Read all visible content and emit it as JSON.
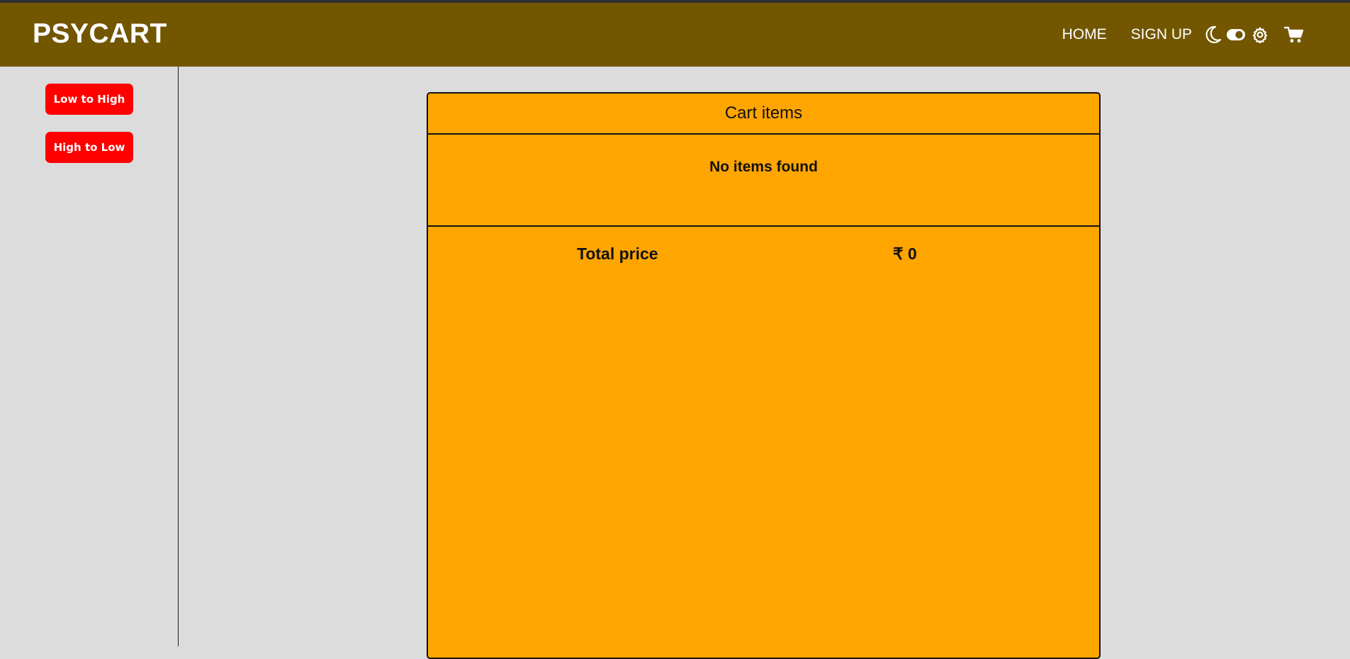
{
  "brand": {
    "name": "PSYCART"
  },
  "nav": {
    "home_label": "HOME",
    "signup_label": "SIGN UP",
    "icons": [
      "moon-icon",
      "toggle-icon",
      "gear-icon",
      "cart-icon"
    ]
  },
  "sidebar": {
    "sort_low_high_label": "Low to High",
    "sort_high_low_label": "High to Low"
  },
  "cart": {
    "header": "Cart items",
    "empty_message": "No items found",
    "total_label": "Total price",
    "total_value": "₹ 0"
  },
  "colors": {
    "navbar": "#725600",
    "page_bg": "#dcdcdc",
    "card_bg": "#ffa500",
    "sort_button": "#ff0000"
  }
}
